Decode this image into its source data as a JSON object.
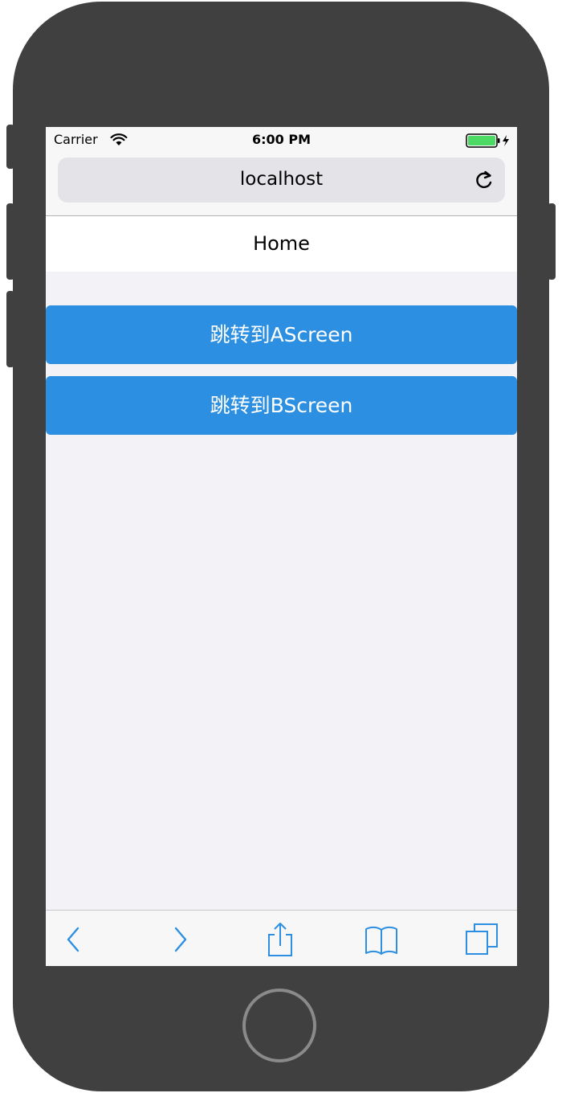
{
  "status_bar": {
    "carrier": "Carrier",
    "time": "6:00 PM"
  },
  "browser": {
    "url": "localhost"
  },
  "app": {
    "title": "Home",
    "buttons": [
      {
        "label": "跳转到AScreen"
      },
      {
        "label": "跳转到BScreen"
      }
    ]
  },
  "toolbar": {
    "items": [
      "back-icon",
      "forward-icon",
      "share-icon",
      "bookmarks-icon",
      "tabs-icon"
    ]
  },
  "colors": {
    "device": "#404040",
    "accent_blue": "#2d8fe1",
    "screen_bg": "#f3f3f7",
    "battery_green": "#4cd964"
  }
}
